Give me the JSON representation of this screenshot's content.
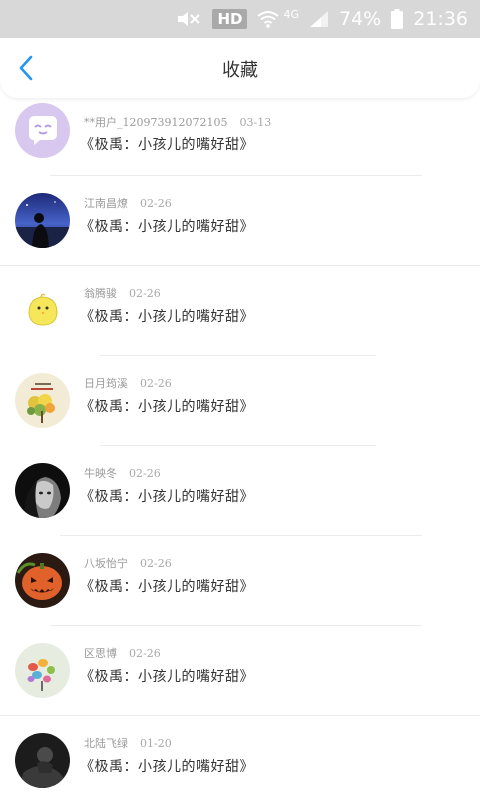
{
  "status_bar": {
    "hd": "HD",
    "network": "4G",
    "battery": "74%",
    "time": "21:36"
  },
  "header": {
    "title": "收藏"
  },
  "favorites": [
    {
      "user": "**用户_120973912072105",
      "date": "03-13",
      "work": "《极禹：小孩儿的嘴好甜》"
    },
    {
      "user": "江南昌燎",
      "date": "02-26",
      "work": "《极禹：小孩儿的嘴好甜》"
    },
    {
      "user": "翁腾骏",
      "date": "02-26",
      "work": "《极禹：小孩儿的嘴好甜》"
    },
    {
      "user": "日月筠溪",
      "date": "02-26",
      "work": "《极禹：小孩儿的嘴好甜》"
    },
    {
      "user": "牛映冬",
      "date": "02-26",
      "work": "《极禹：小孩儿的嘴好甜》"
    },
    {
      "user": "八坂怡宁",
      "date": "02-26",
      "work": "《极禹：小孩儿的嘴好甜》"
    },
    {
      "user": "区思博",
      "date": "02-26",
      "work": "《极禹：小孩儿的嘴好甜》"
    },
    {
      "user": "北陆飞绿",
      "date": "01-20",
      "work": "《极禹：小孩儿的嘴好甜》"
    }
  ],
  "colors": {
    "accent": "#2196f3",
    "status_bar_bg": "#d8d8d8"
  }
}
